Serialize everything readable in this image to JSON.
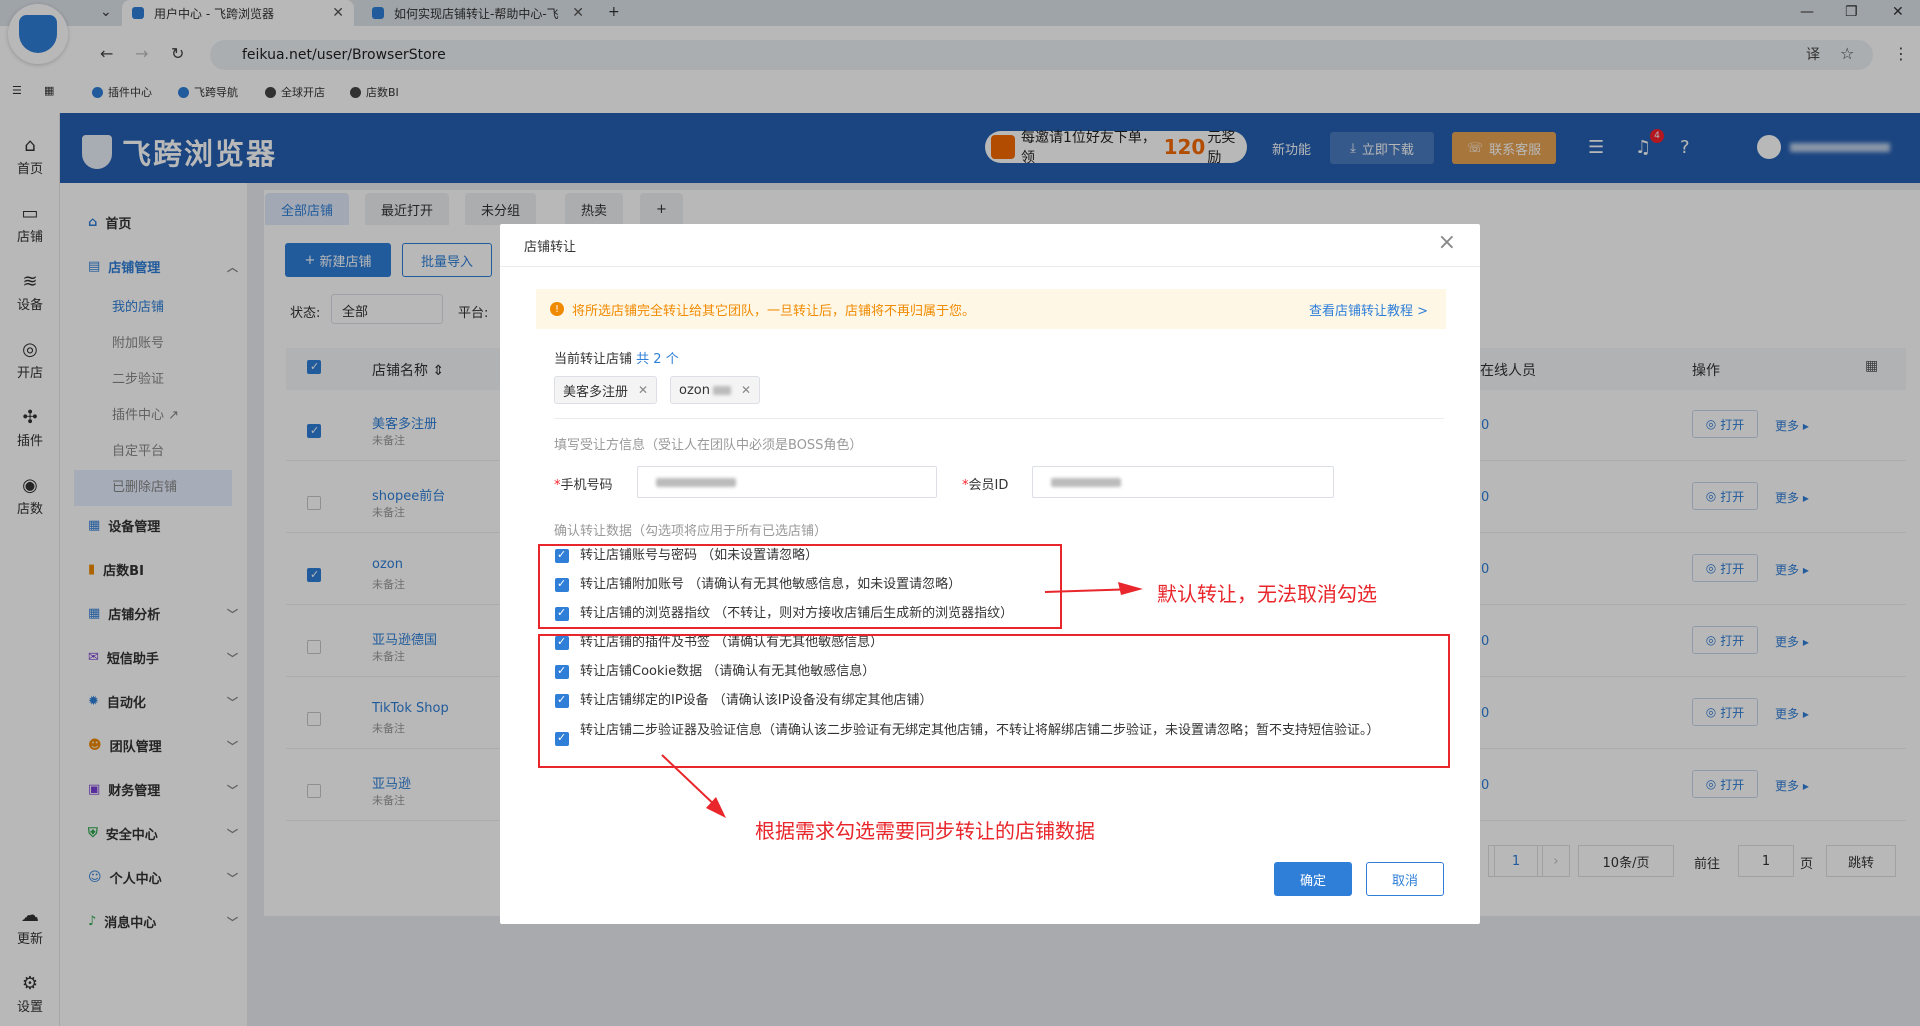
{
  "browser": {
    "tabs": [
      {
        "title": "用户中心 - 飞跨浏览器",
        "active": true
      },
      {
        "title": "如何实现店铺转让-帮助中心-飞",
        "active": false
      }
    ],
    "url": "feikua.net/user/BrowserStore",
    "bookmarks": [
      "插件中心",
      "飞跨导航",
      "全球开店",
      "店数BI"
    ]
  },
  "leftbar": [
    {
      "label": "首页",
      "icon": "home-icon"
    },
    {
      "label": "店铺",
      "icon": "store-icon"
    },
    {
      "label": "设备",
      "icon": "layers-icon"
    },
    {
      "label": "开店",
      "icon": "planet-icon"
    },
    {
      "label": "插件",
      "icon": "puzzle-icon"
    },
    {
      "label": "店数",
      "icon": "bi-icon"
    },
    {
      "label": "更新",
      "icon": "cloud-download-icon"
    },
    {
      "label": "设置",
      "icon": "gear-icon"
    }
  ],
  "header": {
    "brand": "飞跨浏览器",
    "promo_pre": "每邀请1位好友下单，领",
    "promo_amount": "120",
    "promo_post": "元奖励",
    "new_feature": "新功能",
    "download": "立即下载",
    "support": "联系客服",
    "badge_count": "4"
  },
  "sidemenu": {
    "home": "首页",
    "store_mgmt": "店铺管理",
    "subitems": [
      "我的店铺",
      "附加账号",
      "二步验证",
      "插件中心",
      "自定平台",
      "已删除店铺"
    ],
    "groups": [
      "设备管理",
      "店数BI",
      "店铺分析",
      "短信助手",
      "自动化",
      "团队管理",
      "财务管理",
      "安全中心",
      "个人中心",
      "消息中心"
    ]
  },
  "store_tabs": [
    "全部店铺",
    "最近打开",
    "未分组",
    "热卖"
  ],
  "actions": {
    "new_store": "新建店铺",
    "bulk_import": "批量导入"
  },
  "filters": {
    "status_label": "状态:",
    "status_value": "全部",
    "platform_label": "平台:"
  },
  "table": {
    "col_name": "店铺名称",
    "col_online": "在线人员",
    "col_ops": "操作",
    "open": "打开",
    "more": "更多",
    "online_value": "0",
    "rows": [
      {
        "name": "美客多注册",
        "note": "未备注",
        "checked": true
      },
      {
        "name": "shopee前台",
        "note": "未备注",
        "checked": false
      },
      {
        "name": "ozon",
        "note": "未备注",
        "checked": true
      },
      {
        "name": "亚马逊德国",
        "note": "未备注",
        "checked": false
      },
      {
        "name": "TikTok Shop",
        "note": "未备注",
        "checked": false
      },
      {
        "name": "亚马逊",
        "note": "未备注",
        "checked": false
      }
    ]
  },
  "pager": {
    "page": "1",
    "per_page": "10条/页",
    "goto": "前往",
    "goto_value": "1",
    "page_unit": "页",
    "jump": "跳转"
  },
  "modal": {
    "title": "店铺转让",
    "warning": "将所选店铺完全转让给其它团队，一旦转让后，店铺将不再归属于您。",
    "tutorial_link": "查看店铺转让教程 >",
    "current_label": "当前转让店铺",
    "current_count": "共 2 个",
    "chips": [
      "美客多注册",
      "ozon"
    ],
    "receiver_label": "填写受让方信息（受让人在团队中必须是BOSS角色）",
    "phone_label": "手机号码",
    "member_label": "会员ID",
    "confirm_label": "确认转让数据（勾选项将应用于所有已选店铺）",
    "options": [
      "转让店铺账号与密码 （如未设置请忽略）",
      "转让店铺附加账号 （请确认有无其他敏感信息，如未设置请忽略）",
      "转让店铺的浏览器指纹 （不转让，则对方接收店铺后生成新的浏览器指纹）",
      "转让店铺的插件及书签 （请确认有无其他敏感信息）",
      "转让店铺Cookie数据 （请确认有无其他敏感信息）",
      "转让店铺绑定的IP设备 （请确认该IP设备没有绑定其他店铺）",
      "转让店铺二步验证器及验证信息（请确认该二步验证有无绑定其他店铺，不转让将解绑店铺二步验证，未设置请忽略；暂不支持短信验证。）"
    ],
    "ok": "确定",
    "cancel": "取消"
  },
  "annotations": {
    "default_note": "默认转让，无法取消勾选",
    "select_note": "根据需求勾选需要同步转让的店铺数据"
  },
  "colors": {
    "primary": "#2f7fd8",
    "header": "#2560b2",
    "annotation": "#e8262b",
    "warning": "#f08a00"
  }
}
